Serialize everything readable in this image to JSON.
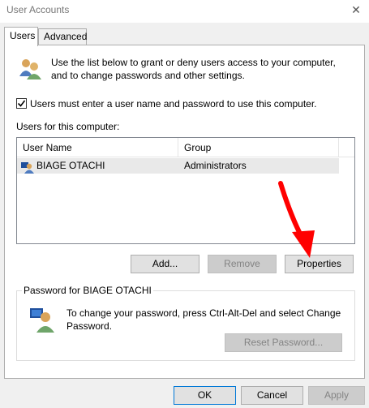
{
  "window": {
    "title": "User Accounts",
    "close_glyph": "✕"
  },
  "tabs": [
    {
      "label": "Users",
      "active": true
    },
    {
      "label": "Advanced",
      "active": false
    }
  ],
  "intro_text": "Use the list below to grant or deny users access to your computer, and to change passwords and other settings.",
  "require_login": {
    "label": "Users must enter a user name and password to use this computer.",
    "checked": true
  },
  "users_list": {
    "label": "Users for this computer:",
    "columns": [
      "User Name",
      "Group"
    ],
    "rows": [
      {
        "user": "BIAGE OTACHI",
        "group": "Administrators"
      }
    ]
  },
  "list_buttons": {
    "add": "Add...",
    "remove": "Remove",
    "properties": "Properties"
  },
  "password_group": {
    "title": "Password for BIAGE OTACHI",
    "text": "To change your password, press Ctrl-Alt-Del and select Change Password.",
    "reset_button": "Reset Password..."
  },
  "dialog_buttons": {
    "ok": "OK",
    "cancel": "Cancel",
    "apply": "Apply"
  },
  "colors": {
    "annotation_arrow": "#ff0000",
    "focus_border": "#0078d7"
  },
  "icons": {
    "users_group": "users-group-icon",
    "user_row": "user-icon",
    "password_user": "user-password-icon",
    "annotation": "red-arrow-annotation"
  }
}
